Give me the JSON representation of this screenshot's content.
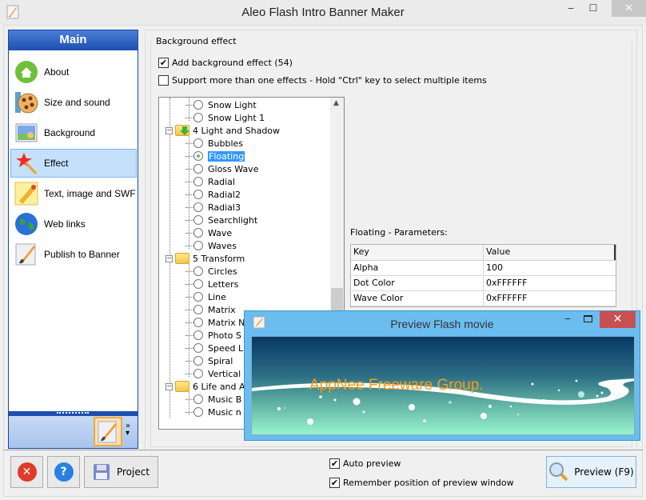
{
  "window": {
    "title": "Aleo Flash Intro Banner Maker",
    "minimize": "‒",
    "maximize": "☐",
    "close": "✕"
  },
  "sidebar": {
    "header": "Main",
    "items": [
      {
        "label": "About",
        "icon": "home-icon",
        "active": false
      },
      {
        "label": "Size and sound",
        "icon": "film-reel-icon",
        "active": false
      },
      {
        "label": "Background",
        "icon": "picture-icon",
        "active": false
      },
      {
        "label": "Effect",
        "icon": "magic-wand-icon",
        "active": true
      },
      {
        "label": "Text, image and SWF",
        "icon": "pencil-icon",
        "active": false
      },
      {
        "label": "Web links",
        "icon": "globe-icon",
        "active": false
      },
      {
        "label": "Publish to Banner",
        "icon": "paintbrush-icon",
        "active": false
      }
    ],
    "more": "»"
  },
  "effect_group": {
    "legend": "Background effect",
    "add_effect": {
      "label": "Add background effect (54)",
      "checked": true
    },
    "multi_effects": {
      "label": "Support more than one effects - Hold \"Ctrl\" key to select multiple items",
      "checked": false
    }
  },
  "tree": {
    "rows": [
      {
        "type": "leaf",
        "label": "Snow Light"
      },
      {
        "type": "leaf",
        "label": "Snow Light 1"
      },
      {
        "type": "folder",
        "label": "4 Light and Shadow",
        "expanded": true,
        "active": true
      },
      {
        "type": "leaf",
        "label": "Bubbles"
      },
      {
        "type": "leaf",
        "label": "Floating",
        "selected": true
      },
      {
        "type": "leaf",
        "label": "Gloss Wave"
      },
      {
        "type": "leaf",
        "label": "Radial"
      },
      {
        "type": "leaf",
        "label": "Radial2"
      },
      {
        "type": "leaf",
        "label": "Radial3"
      },
      {
        "type": "leaf",
        "label": "Searchlight"
      },
      {
        "type": "leaf",
        "label": "Wave"
      },
      {
        "type": "leaf",
        "label": "Waves"
      },
      {
        "type": "folder",
        "label": "5 Transform",
        "expanded": true
      },
      {
        "type": "leaf",
        "label": "Circles"
      },
      {
        "type": "leaf",
        "label": "Letters"
      },
      {
        "type": "leaf",
        "label": "Line"
      },
      {
        "type": "leaf",
        "label": "Matrix"
      },
      {
        "type": "leaf",
        "label": "Matrix N"
      },
      {
        "type": "leaf",
        "label": "Photo S"
      },
      {
        "type": "leaf",
        "label": "Speed L"
      },
      {
        "type": "leaf",
        "label": "Spiral"
      },
      {
        "type": "leaf",
        "label": "Vertical"
      },
      {
        "type": "folder",
        "label": "6 Life and A",
        "expanded": true
      },
      {
        "type": "leaf",
        "label": "Music B"
      },
      {
        "type": "leaf",
        "label": "Music n"
      }
    ]
  },
  "params": {
    "label": "Floating - Parameters:",
    "headers": {
      "key": "Key",
      "value": "Value"
    },
    "rows": [
      {
        "key": "Alpha",
        "value": "100"
      },
      {
        "key": "Dot Color",
        "value": "0xFFFFFF"
      },
      {
        "key": "Wave Color",
        "value": "0xFFFFFF"
      }
    ]
  },
  "preview_window": {
    "title": "Preview Flash movie",
    "close": "✕",
    "minimize": "‒",
    "stage_caption": "AppNee Freeware Group."
  },
  "footer": {
    "project_label": "Project",
    "auto_preview": {
      "label": "Auto preview",
      "checked": true
    },
    "remember_position": {
      "label": "Remember position of preview window",
      "checked": true
    },
    "preview_label": "Preview (F9)"
  }
}
